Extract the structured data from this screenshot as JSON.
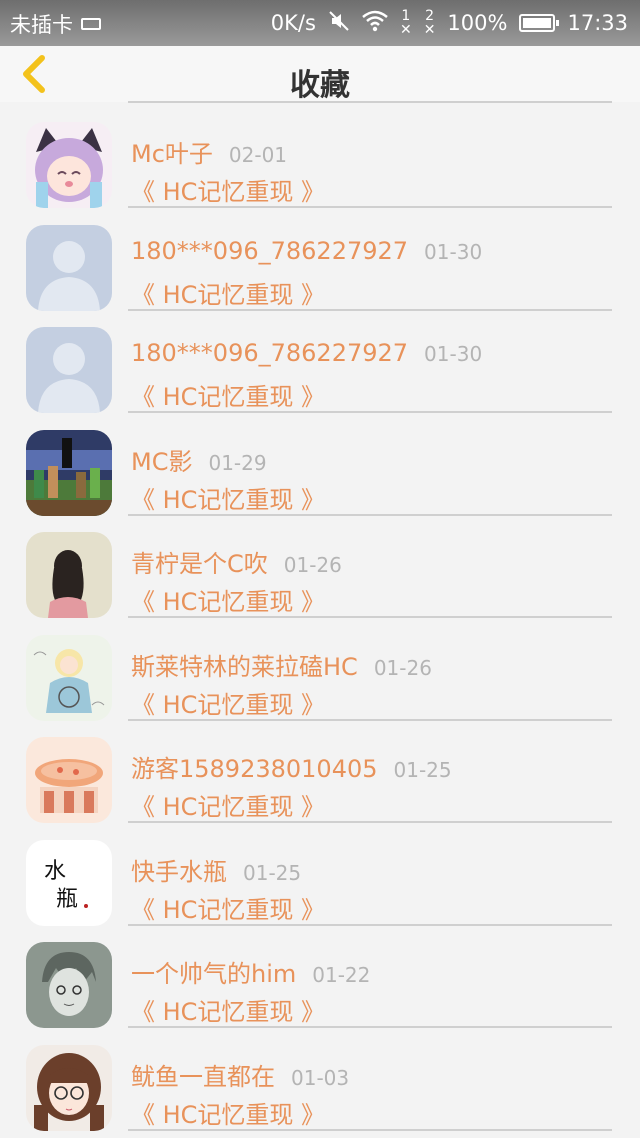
{
  "status_bar": {
    "carrier": "未插卡",
    "speed": "0K/s",
    "sim1": "1",
    "sim2": "2",
    "battery": "100%",
    "time": "17:33"
  },
  "header": {
    "title": "收藏",
    "back_icon": "chevron-left-icon"
  },
  "favorites": [
    {
      "name": "Mc叶子",
      "date": "02-01",
      "work": "《 HC记忆重现 》",
      "avatar": "anime-cat-girl"
    },
    {
      "name": "180***096_786227927",
      "date": "01-30",
      "work": "《 HC记忆重现 》",
      "avatar": "default-person"
    },
    {
      "name": "180***096_786227927",
      "date": "01-30",
      "work": "《 HC记忆重现 》",
      "avatar": "default-person"
    },
    {
      "name": "MC影",
      "date": "01-29",
      "work": "《 HC记忆重现 》",
      "avatar": "minecraft-scene"
    },
    {
      "name": "青柠是个C吹",
      "date": "01-26",
      "work": "《 HC记忆重现 》",
      "avatar": "girl-back"
    },
    {
      "name": "斯莱特林的莱拉磕HC",
      "date": "01-26",
      "work": "《 HC记忆重现 》",
      "avatar": "alice-sketch"
    },
    {
      "name": "游客1589238010405",
      "date": "01-25",
      "work": "《 HC记忆重现 》",
      "avatar": "soup-bowl"
    },
    {
      "name": "快手水瓶",
      "date": "01-25",
      "work": "《 HC记忆重现 》",
      "avatar": "calligraphy"
    },
    {
      "name": "一个帅气的him",
      "date": "01-22",
      "work": "《 HC记忆重现 》",
      "avatar": "anime-boy-sketch"
    },
    {
      "name": "鱿鱼一直都在",
      "date": "01-03",
      "work": "《 HC记忆重现 》",
      "avatar": "anime-girl-glasses"
    }
  ],
  "calligraphy_text": "水瓶",
  "colors": {
    "accent": "#e8925a",
    "date": "#b4b4b4",
    "back_arrow": "#f3c21c"
  }
}
